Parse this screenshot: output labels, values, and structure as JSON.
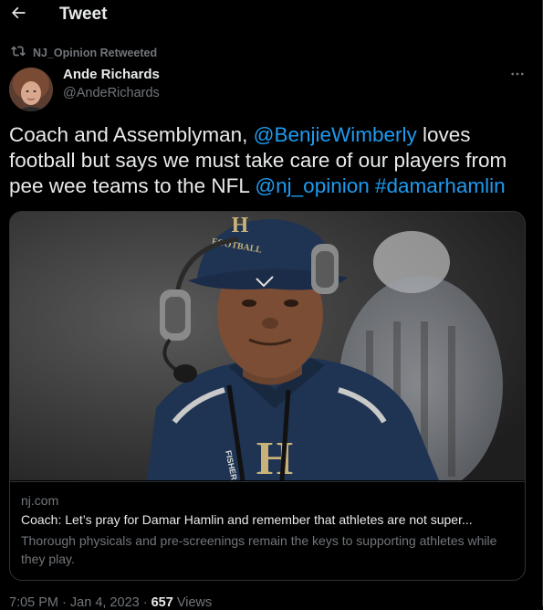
{
  "header": {
    "title": "Tweet"
  },
  "retweet_context": {
    "label": "NJ_Opinion Retweeted"
  },
  "author": {
    "name": "Ande Richards",
    "handle": "@AndeRichards"
  },
  "tweet": {
    "text_1": "Coach and Assemblyman, ",
    "mention_1": "@BenjieWimberly",
    "text_2": " loves football but says we must take care of our players from pee wee teams to the NFL ",
    "mention_2": "@nj_opinion",
    "text_3": " ",
    "hashtag_1": "#damarhamlin"
  },
  "card": {
    "image_cap_letter": "H",
    "image_cap_text": "FOOTBALL",
    "image_jersey_letter": "H",
    "image_lanyard_text": "FISHER",
    "domain": "nj.com",
    "title": "Coach: Let’s pray for Damar Hamlin and remember that athletes are not super...",
    "description": "Thorough physicals and pre-screenings remain the keys to supporting athletes while they play."
  },
  "meta": {
    "time": "7:05 PM",
    "separator": "·",
    "date": "Jan 4, 2023",
    "views_count": "657",
    "views_label": "Views"
  },
  "colors": {
    "background": "#000000",
    "text_primary": "#e7e9ea",
    "text_secondary": "#71767b",
    "link": "#1d9bf0",
    "border": "#2f3336"
  },
  "icons": {
    "back": "arrow-left-icon",
    "retweet": "retweet-icon",
    "more": "more-horizontal-icon"
  }
}
